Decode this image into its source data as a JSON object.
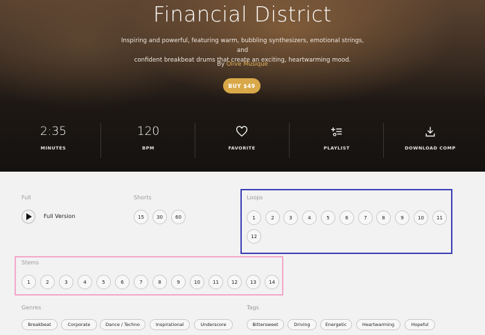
{
  "hero": {
    "title": "Financial District",
    "description_line1": "Inspiring and powerful, featuring warm, bubbling synthesizers, emotional strings, and",
    "description_line2": "confident breakbeat drums that create an exciting, heartwarming mood.",
    "by_prefix": "By",
    "artist": "Olive Musique",
    "buy_label": "BUY $49"
  },
  "stats": [
    {
      "value": "2:35",
      "label": "MINUTES"
    },
    {
      "value": "120",
      "label": "BPM"
    },
    {
      "icon": "heart-icon",
      "label": "FAVORITE"
    },
    {
      "icon": "playlist-add-icon",
      "label": "PLAYLIST"
    },
    {
      "icon": "download-icon",
      "label": "DOWNLOAD COMP"
    }
  ],
  "full": {
    "label": "Full",
    "version_label": "Full Version"
  },
  "shorts": {
    "label": "Shorts",
    "items": [
      "15",
      "30",
      "60"
    ]
  },
  "loops": {
    "label": "Loops",
    "items": [
      "1",
      "2",
      "3",
      "4",
      "5",
      "6",
      "7",
      "8",
      "9",
      "10",
      "11",
      "12"
    ]
  },
  "stems": {
    "label": "Stems",
    "items": [
      "1",
      "2",
      "3",
      "4",
      "5",
      "6",
      "7",
      "8",
      "9",
      "10",
      "11",
      "12",
      "13",
      "14"
    ]
  },
  "genres": {
    "label": "Genres",
    "items": [
      "Breakbeat",
      "Corporate",
      "Dance / Techno",
      "Inspirational",
      "Underscore"
    ]
  },
  "tags": {
    "label": "Tags",
    "items": [
      "Bittersweet",
      "Driving",
      "Energetic",
      "Heartwarming",
      "Hopeful"
    ]
  },
  "colors": {
    "accent": "#d9a849",
    "artist": "#e0b35a",
    "highlight_blue": "#3b3fb5",
    "highlight_pink": "#f2a9c9"
  }
}
